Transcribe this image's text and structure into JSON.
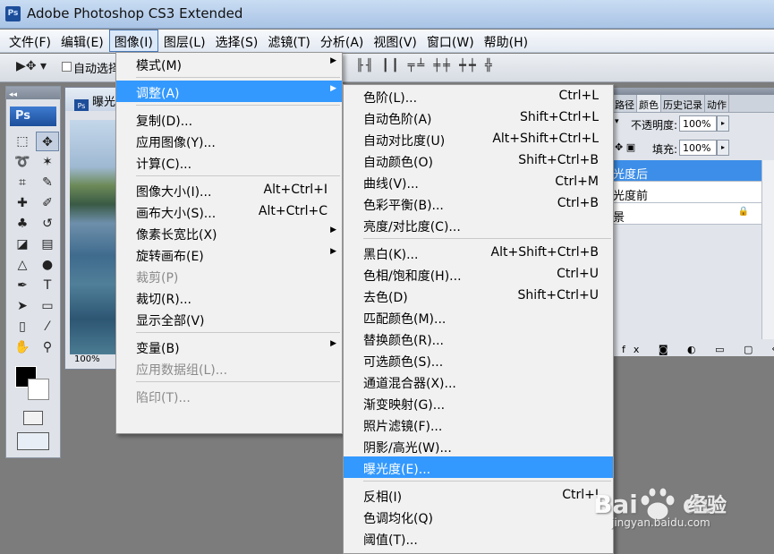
{
  "window": {
    "title": "Adobe Photoshop CS3 Extended",
    "app_icon": "Ps"
  },
  "menubar": [
    "文件(F)",
    "编辑(E)",
    "图像(I)",
    "图层(L)",
    "选择(S)",
    "滤镜(T)",
    "分析(A)",
    "视图(V)",
    "窗口(W)",
    "帮助(H)"
  ],
  "menubar_active": "图像(I)",
  "options": {
    "auto_select_label": "自动选择"
  },
  "toolbox": {
    "badge": "Ps"
  },
  "document": {
    "title": "曝光",
    "zoom": "100%"
  },
  "layers_panel": {
    "tabs": [
      "路径",
      "颜色",
      "历史记录",
      "动作"
    ],
    "opacity_label": "不透明度:",
    "opacity_value": "100%",
    "fill_label": "填充:",
    "fill_value": "100%",
    "layers": [
      "光度后",
      "光度前",
      "景"
    ],
    "selected_layer": "光度后",
    "bottom_icons": "fx"
  },
  "image_menu": {
    "items": [
      {
        "label": "模式(M)",
        "submenu": true
      },
      {
        "sep": true
      },
      {
        "label": "调整(A)",
        "submenu": true,
        "highlight": true
      },
      {
        "sep": true
      },
      {
        "label": "复制(D)..."
      },
      {
        "label": "应用图像(Y)..."
      },
      {
        "label": "计算(C)..."
      },
      {
        "sep": true
      },
      {
        "label": "图像大小(I)...",
        "shortcut": "Alt+Ctrl+I"
      },
      {
        "label": "画布大小(S)...",
        "shortcut": "Alt+Ctrl+C"
      },
      {
        "label": "像素长宽比(X)",
        "submenu": true
      },
      {
        "label": "旋转画布(E)",
        "submenu": true
      },
      {
        "label": "裁剪(P)",
        "disabled": true
      },
      {
        "label": "裁切(R)..."
      },
      {
        "label": "显示全部(V)"
      },
      {
        "sep": true
      },
      {
        "label": "变量(B)",
        "submenu": true
      },
      {
        "label": "应用数据组(L)...",
        "disabled": true
      },
      {
        "sep": true
      },
      {
        "label": "陷印(T)...",
        "disabled": true
      }
    ]
  },
  "adjust_menu": {
    "items": [
      {
        "label": "色阶(L)...",
        "shortcut": "Ctrl+L"
      },
      {
        "label": "自动色阶(A)",
        "shortcut": "Shift+Ctrl+L"
      },
      {
        "label": "自动对比度(U)",
        "shortcut": "Alt+Shift+Ctrl+L"
      },
      {
        "label": "自动颜色(O)",
        "shortcut": "Shift+Ctrl+B"
      },
      {
        "label": "曲线(V)...",
        "shortcut": "Ctrl+M"
      },
      {
        "label": "色彩平衡(B)...",
        "shortcut": "Ctrl+B"
      },
      {
        "label": "亮度/对比度(C)..."
      },
      {
        "sep": true
      },
      {
        "label": "黑白(K)...",
        "shortcut": "Alt+Shift+Ctrl+B"
      },
      {
        "label": "色相/饱和度(H)...",
        "shortcut": "Ctrl+U"
      },
      {
        "label": "去色(D)",
        "shortcut": "Shift+Ctrl+U"
      },
      {
        "label": "匹配颜色(M)..."
      },
      {
        "label": "替换颜色(R)..."
      },
      {
        "label": "可选颜色(S)..."
      },
      {
        "label": "通道混合器(X)..."
      },
      {
        "label": "渐变映射(G)..."
      },
      {
        "label": "照片滤镜(F)..."
      },
      {
        "label": "阴影/高光(W)..."
      },
      {
        "label": "曝光度(E)...",
        "highlight": true
      },
      {
        "sep": true
      },
      {
        "label": "反相(I)",
        "shortcut": "Ctrl+I"
      },
      {
        "label": "色调均化(Q)"
      },
      {
        "label": "阈值(T)..."
      }
    ]
  },
  "watermark": {
    "brand": "Bai",
    "brand2": "du",
    "jingyan": "经验",
    "url": "jingyan.baidu.com"
  },
  "colors": {
    "highlight": "#3399ff",
    "selected_layer": "#3d8ee8",
    "menubar_active_border": "#4a79b8"
  }
}
